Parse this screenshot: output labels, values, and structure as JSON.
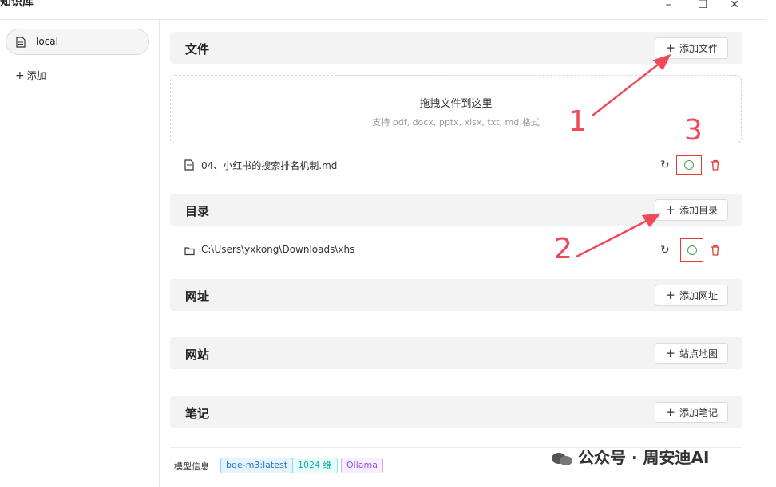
{
  "window": {
    "title": "知识库",
    "minimize_icon": "minimize-icon",
    "maximize_icon": "maximize-icon",
    "close_icon": "close-icon"
  },
  "sidebar": {
    "items": [
      {
        "label": "local",
        "icon": "document-icon"
      }
    ],
    "add_label": "添加"
  },
  "sections": {
    "files": {
      "title": "文件",
      "add_label": "添加文件",
      "dropzone_title": "拖拽文件到这里",
      "dropzone_hint": "支持 pdf, docx, pptx, xlsx, txt, md 格式",
      "items": [
        {
          "name": "04、小红书的搜索排名机制.md",
          "icon": "file-icon"
        }
      ]
    },
    "directories": {
      "title": "目录",
      "add_label": "添加目录",
      "items": [
        {
          "name": "C:\\Users\\yxkong\\Downloads\\xhs",
          "icon": "folder-icon"
        }
      ]
    },
    "urls": {
      "title": "网址",
      "add_label": "添加网址"
    },
    "sites": {
      "title": "网站",
      "add_label": "站点地图"
    },
    "notes": {
      "title": "笔记",
      "add_label": "添加笔记"
    }
  },
  "model_info": {
    "label": "模型信息",
    "tags": [
      {
        "text": "bge-m3:latest",
        "color": "#1e6fd9"
      },
      {
        "text": "1024 维",
        "color": "#13a8a8"
      },
      {
        "text": "Ollama",
        "color": "#9254de"
      }
    ]
  },
  "annotations": {
    "n1": "1",
    "n2": "2",
    "n3": "3",
    "color": "#f04a5a"
  },
  "watermark": {
    "text": "公众号 · 周安迪AI"
  }
}
